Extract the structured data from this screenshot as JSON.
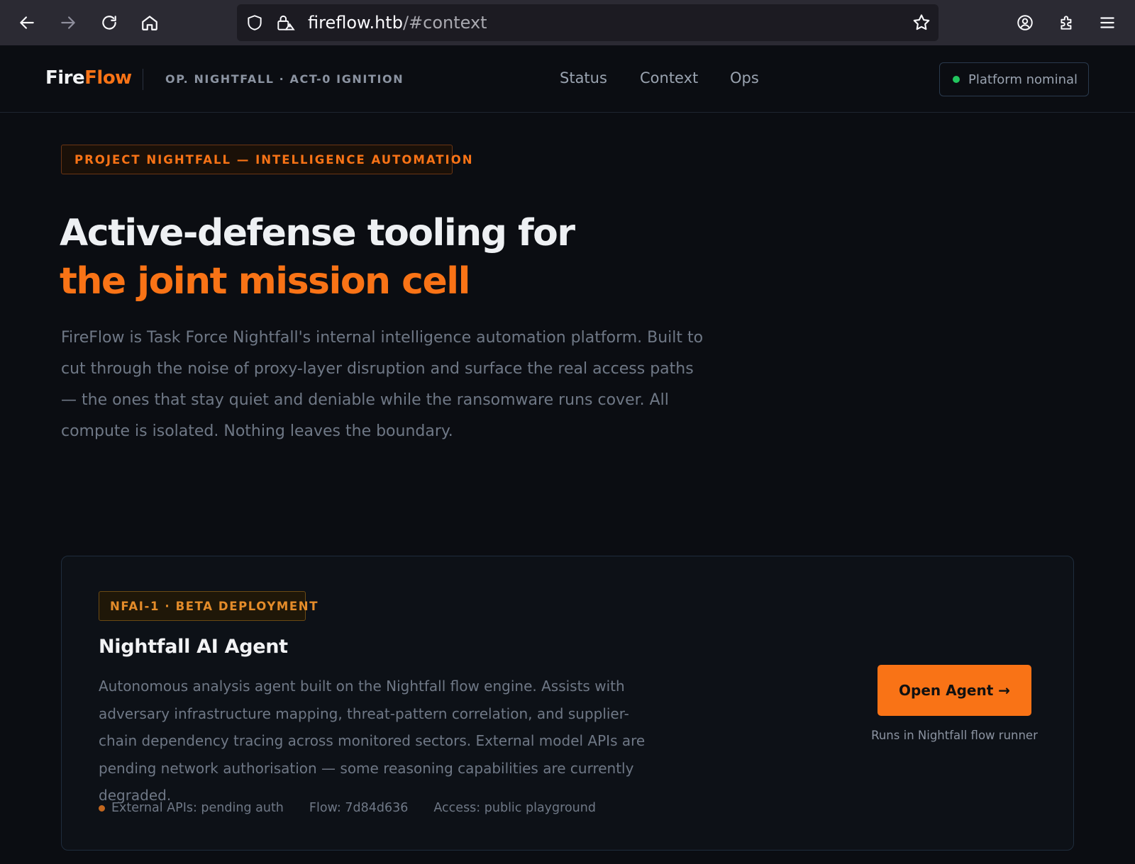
{
  "browser": {
    "url_host": "fireflow.htb",
    "url_path": "/#context"
  },
  "header": {
    "logo_primary": "Fire",
    "logo_accent": "Flow",
    "op_label": "OP. NIGHTFALL · ACT-0 IGNITION",
    "nav": [
      "Status",
      "Context",
      "Ops"
    ],
    "status_text": "Platform nominal",
    "status_color": "#22c55e"
  },
  "hero": {
    "tag": "PROJECT NIGHTFALL — INTELLIGENCE AUTOMATION",
    "title_line1": "Active-defense tooling for",
    "title_line2": "the joint mission cell",
    "description": "FireFlow is Task Force Nightfall's internal intelligence automation platform. Built to cut through the noise of proxy-layer disruption and surface the real access paths — the ones that stay quiet and deniable while the ransomware runs cover. All compute is isolated. Nothing leaves the boundary."
  },
  "agent": {
    "badge": "NFAI-1 · BETA DEPLOYMENT",
    "title": "Nightfall AI Agent",
    "description": "Autonomous analysis agent built on the Nightfall flow engine. Assists with adversary infrastructure mapping, threat-pattern correlation, and supplier-chain dependency tracing across monitored sectors. External model APIs are pending network authorisation — some reasoning capabilities are currently degraded.",
    "meta_apis": "External APIs: pending auth",
    "meta_flow": "Flow: 7d84d636",
    "meta_access": "Access: public playground",
    "button_label": "Open Agent →",
    "button_caption": "Runs in Nightfall flow runner"
  },
  "colors": {
    "accent": "#f97316",
    "background": "#0b0d12"
  }
}
